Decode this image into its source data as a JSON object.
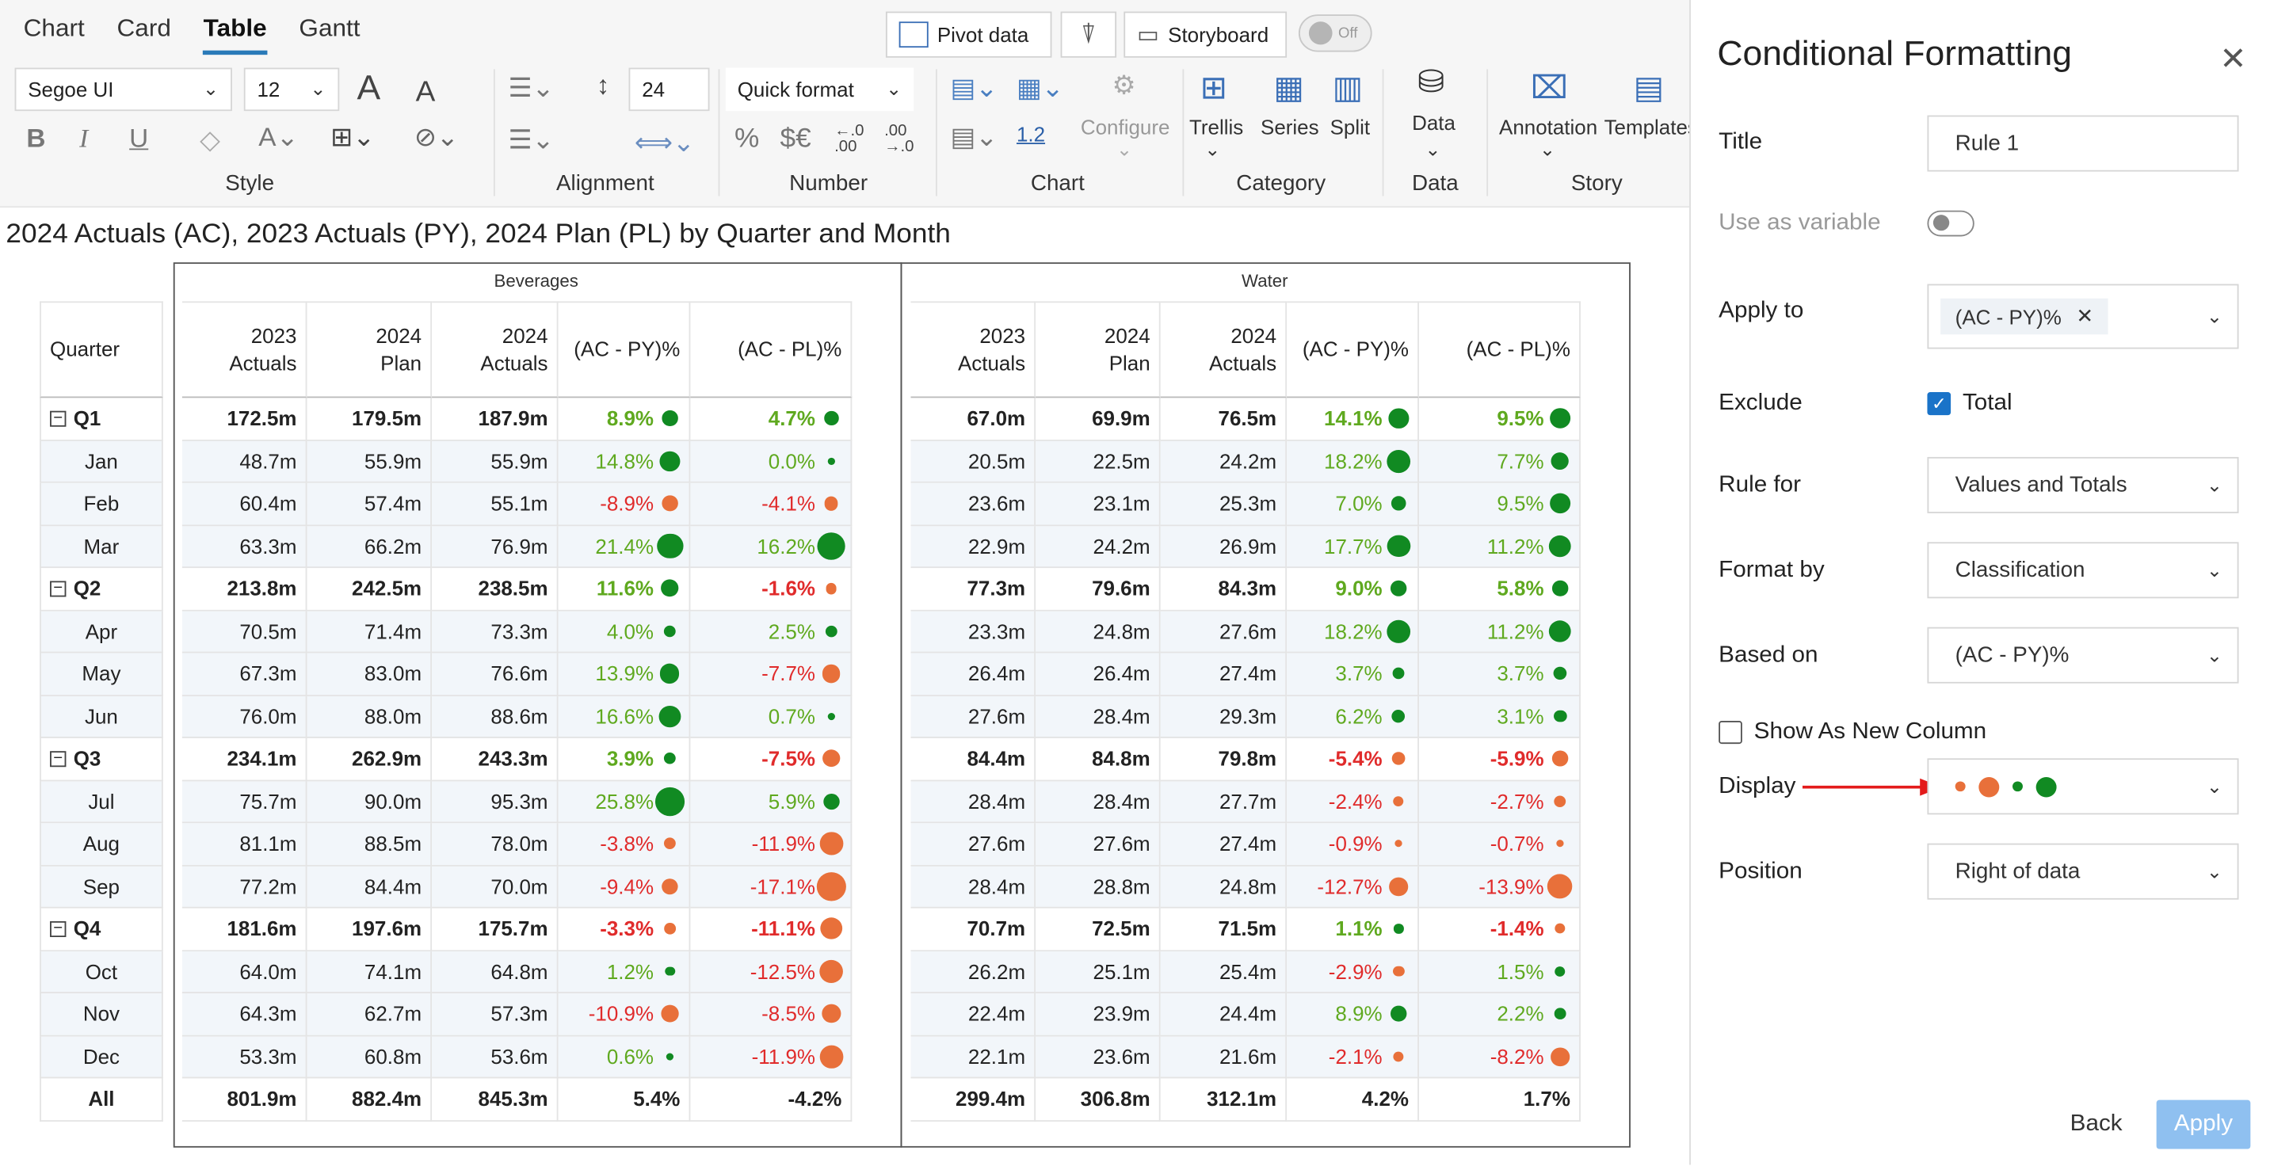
{
  "tabs": [
    "Chart",
    "Card",
    "Table",
    "Gantt"
  ],
  "toolbar": {
    "pivot": "Pivot data",
    "storyboard": "Storyboard",
    "toggle": "Off",
    "font": "Segoe UI",
    "size": "12",
    "rowheight": "24",
    "quickformat": "Quick format",
    "bold": "B",
    "italic": "I",
    "underline": "U",
    "grow": "A",
    "shrink": "A",
    "percent": "%",
    "currency": "$€",
    "dec_more": "←.0\n.00",
    "dec_less": ".00\n→.0",
    "fmt12": "1.2",
    "configure": "Configure",
    "trellis": "Trellis",
    "series": "Series",
    "split": "Split",
    "data": "Data",
    "annotation": "Annotation",
    "templates": "Templates",
    "groups": [
      "Style",
      "Alignment",
      "Number",
      "Chart",
      "Category",
      "Data",
      "Story"
    ]
  },
  "title": "2024 Actuals (AC), 2023 Actuals (PY), 2024 Plan (PL) by Quarter and Month",
  "table": {
    "groups": [
      "Beverages",
      "Water"
    ],
    "quarter_header": "Quarter",
    "headers": [
      "2023 Actuals",
      "2024 Plan",
      "2024 Actuals",
      "(AC - PY)%",
      "(AC - PL)%"
    ],
    "rows": [
      {
        "label": "Q1",
        "bold": true,
        "bev": [
          "172.5m",
          "179.5m",
          "187.9m",
          "8.9%",
          "4.7%"
        ],
        "wat": [
          "67.0m",
          "69.9m",
          "76.5m",
          "14.1%",
          "9.5%"
        ]
      },
      {
        "label": "Jan",
        "bev": [
          "48.7m",
          "55.9m",
          "55.9m",
          "14.8%",
          "0.0%"
        ],
        "wat": [
          "20.5m",
          "22.5m",
          "24.2m",
          "18.2%",
          "7.7%"
        ]
      },
      {
        "label": "Feb",
        "bev": [
          "60.4m",
          "57.4m",
          "55.1m",
          "-8.9%",
          "-4.1%"
        ],
        "wat": [
          "23.6m",
          "23.1m",
          "25.3m",
          "7.0%",
          "9.5%"
        ]
      },
      {
        "label": "Mar",
        "bev": [
          "63.3m",
          "66.2m",
          "76.9m",
          "21.4%",
          "16.2%"
        ],
        "wat": [
          "22.9m",
          "24.2m",
          "26.9m",
          "17.7%",
          "11.2%"
        ]
      },
      {
        "label": "Q2",
        "bold": true,
        "bev": [
          "213.8m",
          "242.5m",
          "238.5m",
          "11.6%",
          "-1.6%"
        ],
        "wat": [
          "77.3m",
          "79.6m",
          "84.3m",
          "9.0%",
          "5.8%"
        ]
      },
      {
        "label": "Apr",
        "bev": [
          "70.5m",
          "71.4m",
          "73.3m",
          "4.0%",
          "2.5%"
        ],
        "wat": [
          "23.3m",
          "24.8m",
          "27.6m",
          "18.2%",
          "11.2%"
        ]
      },
      {
        "label": "May",
        "bev": [
          "67.3m",
          "83.0m",
          "76.6m",
          "13.9%",
          "-7.7%"
        ],
        "wat": [
          "26.4m",
          "26.4m",
          "27.4m",
          "3.7%",
          "3.7%"
        ]
      },
      {
        "label": "Jun",
        "bev": [
          "76.0m",
          "88.0m",
          "88.6m",
          "16.6%",
          "0.7%"
        ],
        "wat": [
          "27.6m",
          "28.4m",
          "29.3m",
          "6.2%",
          "3.1%"
        ]
      },
      {
        "label": "Q3",
        "bold": true,
        "bev": [
          "234.1m",
          "262.9m",
          "243.3m",
          "3.9%",
          "-7.5%"
        ],
        "wat": [
          "84.4m",
          "84.8m",
          "79.8m",
          "-5.4%",
          "-5.9%"
        ]
      },
      {
        "label": "Jul",
        "bev": [
          "75.7m",
          "90.0m",
          "95.3m",
          "25.8%",
          "5.9%"
        ],
        "wat": [
          "28.4m",
          "28.4m",
          "27.7m",
          "-2.4%",
          "-2.7%"
        ]
      },
      {
        "label": "Aug",
        "bev": [
          "81.1m",
          "88.5m",
          "78.0m",
          "-3.8%",
          "-11.9%"
        ],
        "wat": [
          "27.6m",
          "27.6m",
          "27.4m",
          "-0.9%",
          "-0.7%"
        ]
      },
      {
        "label": "Sep",
        "bev": [
          "77.2m",
          "84.4m",
          "70.0m",
          "-9.4%",
          "-17.1%"
        ],
        "wat": [
          "28.4m",
          "28.8m",
          "24.8m",
          "-12.7%",
          "-13.9%"
        ]
      },
      {
        "label": "Q4",
        "bold": true,
        "bev": [
          "181.6m",
          "197.6m",
          "175.7m",
          "-3.3%",
          "-11.1%"
        ],
        "wat": [
          "70.7m",
          "72.5m",
          "71.5m",
          "1.1%",
          "-1.4%"
        ]
      },
      {
        "label": "Oct",
        "bev": [
          "64.0m",
          "74.1m",
          "64.8m",
          "1.2%",
          "-12.5%"
        ],
        "wat": [
          "26.2m",
          "25.1m",
          "25.4m",
          "-2.9%",
          "1.5%"
        ]
      },
      {
        "label": "Nov",
        "bev": [
          "64.3m",
          "62.7m",
          "57.3m",
          "-10.9%",
          "-8.5%"
        ],
        "wat": [
          "22.4m",
          "23.9m",
          "24.4m",
          "8.9%",
          "2.2%"
        ]
      },
      {
        "label": "Dec",
        "bev": [
          "53.3m",
          "60.8m",
          "53.6m",
          "0.6%",
          "-11.9%"
        ],
        "wat": [
          "22.1m",
          "23.6m",
          "21.6m",
          "-2.1%",
          "-8.2%"
        ]
      },
      {
        "label": "All",
        "bold": true,
        "total": true,
        "bev": [
          "801.9m",
          "882.4m",
          "845.3m",
          "5.4%",
          "-4.2%"
        ],
        "wat": [
          "299.4m",
          "306.8m",
          "312.1m",
          "4.2%",
          "1.7%"
        ]
      }
    ],
    "colors": {
      "positive_text": "#5fa91f",
      "negative_text": "#e02b2b",
      "positive_dot": "#118a22",
      "negative_dot": "#e8703a"
    }
  },
  "panel": {
    "title": "Conditional Formatting",
    "title_label": "Title",
    "title_value": "Rule 1",
    "use_as_variable": "Use as variable",
    "apply_to": "Apply to",
    "apply_to_value": "(AC - PY)%",
    "exclude": "Exclude",
    "exclude_value": "Total",
    "rule_for": "Rule for",
    "rule_for_value": "Values and Totals",
    "format_by": "Format by",
    "format_by_value": "Classification",
    "based_on": "Based on",
    "based_on_value": "(AC - PY)%",
    "show_new_column": "Show As New Column",
    "display": "Display",
    "position": "Position",
    "position_value": "Right of data",
    "back": "Back",
    "apply": "Apply"
  }
}
